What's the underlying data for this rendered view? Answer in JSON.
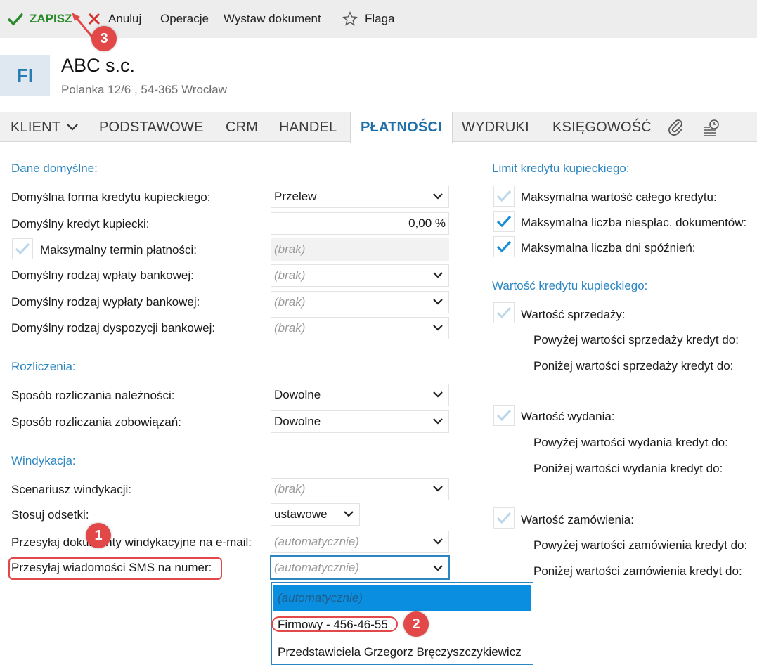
{
  "toolbar": {
    "save": "ZAPISZ",
    "cancel": "Anuluj",
    "operations": "Operacje",
    "issue_document": "Wystaw dokument",
    "flag": "Flaga"
  },
  "header": {
    "initials": "FI",
    "company": "ABC s.c.",
    "address": "Polanka  12/6 , 54-365 Wrocław"
  },
  "tabs": [
    "KLIENT",
    "PODSTAWOWE",
    "CRM",
    "HANDEL",
    "PŁATNOŚCI",
    "WYDRUKI",
    "KSIĘGOWOŚĆ"
  ],
  "active_tab": "PŁATNOŚCI",
  "defaults": {
    "title": "Dane domyślne:",
    "credit_form_label": "Domyślna forma kredytu kupieckiego:",
    "credit_form_value": "Przelew",
    "credit_label": "Domyślny kredyt kupiecki:",
    "credit_value": "0,00 %",
    "max_term_label": "Maksymalny termin płatności:",
    "max_term_value": "(brak)",
    "deposit_label": "Domyślny rodzaj wpłaty bankowej:",
    "deposit_value": "(brak)",
    "payout_label": "Domyślny rodzaj wypłaty bankowej:",
    "payout_value": "(brak)",
    "disposition_label": "Domyślny rodzaj dyspozycji bankowej:",
    "disposition_value": "(brak)"
  },
  "settlements": {
    "title": "Rozliczenia:",
    "receivables_label": "Sposób rozliczania należności:",
    "receivables_value": "Dowolne",
    "liabilities_label": "Sposób rozliczania zobowiązań:",
    "liabilities_value": "Dowolne"
  },
  "collection": {
    "title": "Windykacja:",
    "scenario_label": "Scenariusz windykacji:",
    "scenario_value": "(brak)",
    "interest_label": "Stosuj odsetki:",
    "interest_value": "ustawowe",
    "email_label": "Przesyłaj dokumenty windykacyjne na e-mail:",
    "email_value": "(automatycznie)",
    "sms_label": "Przesyłaj wiadomości SMS na numer:",
    "sms_value": "(automatycznie)"
  },
  "sms_dropdown": {
    "options": [
      "(automatycznie)",
      "Firmowy - 456-46-55",
      "Przedstawiciela Grzegorz Bręczyszczykiewicz"
    ]
  },
  "credit_limit": {
    "title": "Limit kredytu kupieckiego:",
    "items": [
      {
        "label": "Maksymalna wartość całego kredytu:",
        "checked": false
      },
      {
        "label": "Maksymalna liczba niespłac. dokumentów:",
        "checked": true
      },
      {
        "label": "Maksymalna liczba dni spóźnień:",
        "checked": true
      }
    ]
  },
  "credit_value": {
    "title": "Wartość kredytu kupieckiego:",
    "sales_label": "Wartość sprzedaży:",
    "sales_above": "Powyżej wartości sprzedaży kredyt do:",
    "sales_below": "Poniżej wartości sprzedaży kredyt do:",
    "issue_label": "Wartość wydania:",
    "issue_above": "Powyżej wartości wydania kredyt do:",
    "issue_below": "Poniżej wartości wydania kredyt do:",
    "order_label": "Wartość zamówienia:",
    "order_above": "Powyżej wartości zamówienia kredyt do:",
    "order_below": "Poniżej wartości zamówienia kredyt do:"
  },
  "annotations": {
    "badge1": "1",
    "badge2": "2",
    "badge3": "3"
  },
  "colors": {
    "accent": "#2b86c2",
    "save": "#2b8a2b",
    "annotation": "#e34848",
    "selection": "#0a8ee0"
  }
}
